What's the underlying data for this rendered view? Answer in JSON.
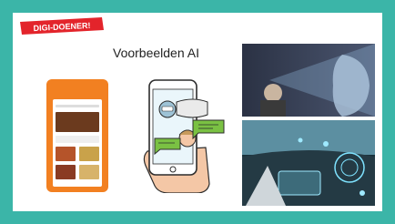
{
  "badge": {
    "text": "DIGI-DOENER!"
  },
  "slide": {
    "title": "Voorbeelden AI"
  },
  "images": {
    "food_app": "food-delivery-app-phone",
    "chatbot": "chatbot-phone-illustration",
    "face_scan": "face-recognition-photo",
    "car": "self-driving-car-photo"
  },
  "colors": {
    "frame": "#3bb5a8",
    "badge": "#e3242b",
    "app_orange": "#f28021",
    "bubble_green": "#7ac143"
  }
}
